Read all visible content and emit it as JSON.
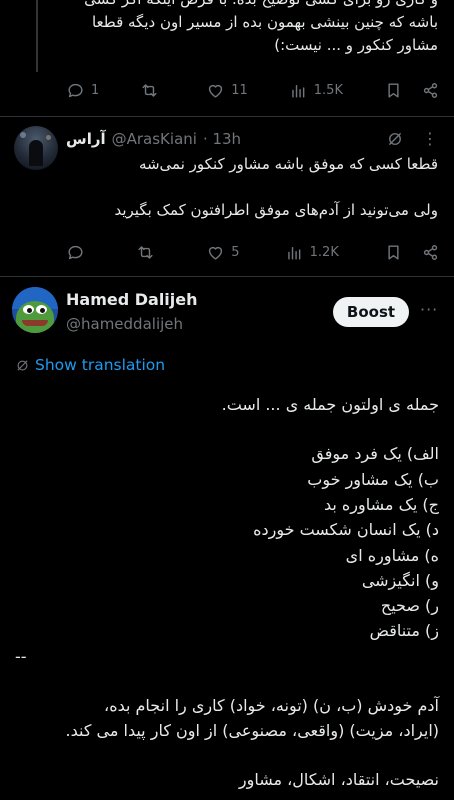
{
  "top_tweet": {
    "lines": [
      "و کاری رو برای کسی توضیح بده. با فرض اینکه اگر کسی",
      "باشه که چنین بینشی بهمون بده از مسیر اون دیگه قطعا",
      "مشاور کنکور و ... نیست:)"
    ],
    "actions": {
      "replies": "1",
      "retweets": "",
      "likes": "11",
      "views": "1.5K"
    }
  },
  "reply_tweet": {
    "name": "آراس",
    "handle": "@ArasKiani",
    "time": "· 13h",
    "paragraphs": [
      "قطعا کسی که موفق باشه مشاور کنکور نمی‌شه",
      "ولی می‌تونید از آدم‌های موفق اطرافتون کمک بگیرید"
    ],
    "actions": {
      "replies": "",
      "retweets": "",
      "likes": "5",
      "views": "1.2K"
    }
  },
  "main_tweet": {
    "name": "Hamed Dalijeh",
    "handle": "@hameddalijeh",
    "boost_label": "Boost",
    "more_label": "···",
    "show_translation": "Show translation",
    "lines": [
      "جمله ی اولتون جمله ی ... است.",
      "",
      "الف) یک فرد موفق",
      "ب) یک مشاور خوب",
      "ج) یک مشاوره بد",
      "د) یک انسان شکست خورده",
      "ه) مشاوره ای",
      "و) انگیزشی",
      "ر) صحیح",
      "ز) متناقض",
      "--",
      "",
      "آدم خودش (ب، ن) (تونه، خواد) کاری را انجام بده،",
      "(ایراد، مزیت) (واقعی، مصنوعی) از اون کار پیدا می کند.",
      "",
      "نصیحت، انتقاد، اشکال، مشاور"
    ]
  },
  "colors": {
    "background": "#000000",
    "text": "#e7e9ea",
    "muted": "#71767b",
    "link": "#1d9bf0",
    "divider": "#2f3336"
  }
}
